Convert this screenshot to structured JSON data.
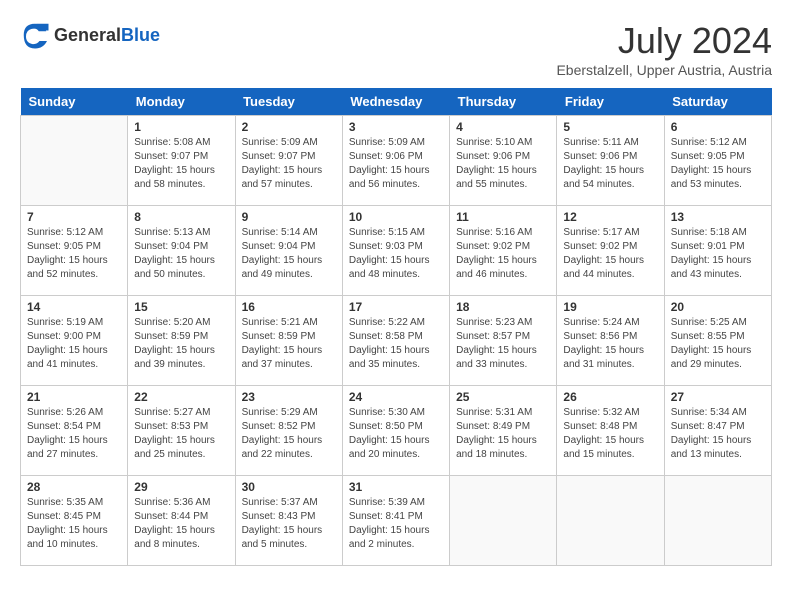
{
  "logo": {
    "general": "General",
    "blue": "Blue"
  },
  "title": "July 2024",
  "subtitle": "Eberstalzell, Upper Austria, Austria",
  "days_of_week": [
    "Sunday",
    "Monday",
    "Tuesday",
    "Wednesday",
    "Thursday",
    "Friday",
    "Saturday"
  ],
  "weeks": [
    [
      {
        "day": "",
        "sunrise": "",
        "sunset": "",
        "daylight": ""
      },
      {
        "day": "1",
        "sunrise": "Sunrise: 5:08 AM",
        "sunset": "Sunset: 9:07 PM",
        "daylight": "Daylight: 15 hours and 58 minutes."
      },
      {
        "day": "2",
        "sunrise": "Sunrise: 5:09 AM",
        "sunset": "Sunset: 9:07 PM",
        "daylight": "Daylight: 15 hours and 57 minutes."
      },
      {
        "day": "3",
        "sunrise": "Sunrise: 5:09 AM",
        "sunset": "Sunset: 9:06 PM",
        "daylight": "Daylight: 15 hours and 56 minutes."
      },
      {
        "day": "4",
        "sunrise": "Sunrise: 5:10 AM",
        "sunset": "Sunset: 9:06 PM",
        "daylight": "Daylight: 15 hours and 55 minutes."
      },
      {
        "day": "5",
        "sunrise": "Sunrise: 5:11 AM",
        "sunset": "Sunset: 9:06 PM",
        "daylight": "Daylight: 15 hours and 54 minutes."
      },
      {
        "day": "6",
        "sunrise": "Sunrise: 5:12 AM",
        "sunset": "Sunset: 9:05 PM",
        "daylight": "Daylight: 15 hours and 53 minutes."
      }
    ],
    [
      {
        "day": "7",
        "sunrise": "Sunrise: 5:12 AM",
        "sunset": "Sunset: 9:05 PM",
        "daylight": "Daylight: 15 hours and 52 minutes."
      },
      {
        "day": "8",
        "sunrise": "Sunrise: 5:13 AM",
        "sunset": "Sunset: 9:04 PM",
        "daylight": "Daylight: 15 hours and 50 minutes."
      },
      {
        "day": "9",
        "sunrise": "Sunrise: 5:14 AM",
        "sunset": "Sunset: 9:04 PM",
        "daylight": "Daylight: 15 hours and 49 minutes."
      },
      {
        "day": "10",
        "sunrise": "Sunrise: 5:15 AM",
        "sunset": "Sunset: 9:03 PM",
        "daylight": "Daylight: 15 hours and 48 minutes."
      },
      {
        "day": "11",
        "sunrise": "Sunrise: 5:16 AM",
        "sunset": "Sunset: 9:02 PM",
        "daylight": "Daylight: 15 hours and 46 minutes."
      },
      {
        "day": "12",
        "sunrise": "Sunrise: 5:17 AM",
        "sunset": "Sunset: 9:02 PM",
        "daylight": "Daylight: 15 hours and 44 minutes."
      },
      {
        "day": "13",
        "sunrise": "Sunrise: 5:18 AM",
        "sunset": "Sunset: 9:01 PM",
        "daylight": "Daylight: 15 hours and 43 minutes."
      }
    ],
    [
      {
        "day": "14",
        "sunrise": "Sunrise: 5:19 AM",
        "sunset": "Sunset: 9:00 PM",
        "daylight": "Daylight: 15 hours and 41 minutes."
      },
      {
        "day": "15",
        "sunrise": "Sunrise: 5:20 AM",
        "sunset": "Sunset: 8:59 PM",
        "daylight": "Daylight: 15 hours and 39 minutes."
      },
      {
        "day": "16",
        "sunrise": "Sunrise: 5:21 AM",
        "sunset": "Sunset: 8:59 PM",
        "daylight": "Daylight: 15 hours and 37 minutes."
      },
      {
        "day": "17",
        "sunrise": "Sunrise: 5:22 AM",
        "sunset": "Sunset: 8:58 PM",
        "daylight": "Daylight: 15 hours and 35 minutes."
      },
      {
        "day": "18",
        "sunrise": "Sunrise: 5:23 AM",
        "sunset": "Sunset: 8:57 PM",
        "daylight": "Daylight: 15 hours and 33 minutes."
      },
      {
        "day": "19",
        "sunrise": "Sunrise: 5:24 AM",
        "sunset": "Sunset: 8:56 PM",
        "daylight": "Daylight: 15 hours and 31 minutes."
      },
      {
        "day": "20",
        "sunrise": "Sunrise: 5:25 AM",
        "sunset": "Sunset: 8:55 PM",
        "daylight": "Daylight: 15 hours and 29 minutes."
      }
    ],
    [
      {
        "day": "21",
        "sunrise": "Sunrise: 5:26 AM",
        "sunset": "Sunset: 8:54 PM",
        "daylight": "Daylight: 15 hours and 27 minutes."
      },
      {
        "day": "22",
        "sunrise": "Sunrise: 5:27 AM",
        "sunset": "Sunset: 8:53 PM",
        "daylight": "Daylight: 15 hours and 25 minutes."
      },
      {
        "day": "23",
        "sunrise": "Sunrise: 5:29 AM",
        "sunset": "Sunset: 8:52 PM",
        "daylight": "Daylight: 15 hours and 22 minutes."
      },
      {
        "day": "24",
        "sunrise": "Sunrise: 5:30 AM",
        "sunset": "Sunset: 8:50 PM",
        "daylight": "Daylight: 15 hours and 20 minutes."
      },
      {
        "day": "25",
        "sunrise": "Sunrise: 5:31 AM",
        "sunset": "Sunset: 8:49 PM",
        "daylight": "Daylight: 15 hours and 18 minutes."
      },
      {
        "day": "26",
        "sunrise": "Sunrise: 5:32 AM",
        "sunset": "Sunset: 8:48 PM",
        "daylight": "Daylight: 15 hours and 15 minutes."
      },
      {
        "day": "27",
        "sunrise": "Sunrise: 5:34 AM",
        "sunset": "Sunset: 8:47 PM",
        "daylight": "Daylight: 15 hours and 13 minutes."
      }
    ],
    [
      {
        "day": "28",
        "sunrise": "Sunrise: 5:35 AM",
        "sunset": "Sunset: 8:45 PM",
        "daylight": "Daylight: 15 hours and 10 minutes."
      },
      {
        "day": "29",
        "sunrise": "Sunrise: 5:36 AM",
        "sunset": "Sunset: 8:44 PM",
        "daylight": "Daylight: 15 hours and 8 minutes."
      },
      {
        "day": "30",
        "sunrise": "Sunrise: 5:37 AM",
        "sunset": "Sunset: 8:43 PM",
        "daylight": "Daylight: 15 hours and 5 minutes."
      },
      {
        "day": "31",
        "sunrise": "Sunrise: 5:39 AM",
        "sunset": "Sunset: 8:41 PM",
        "daylight": "Daylight: 15 hours and 2 minutes."
      },
      {
        "day": "",
        "sunrise": "",
        "sunset": "",
        "daylight": ""
      },
      {
        "day": "",
        "sunrise": "",
        "sunset": "",
        "daylight": ""
      },
      {
        "day": "",
        "sunrise": "",
        "sunset": "",
        "daylight": ""
      }
    ]
  ]
}
